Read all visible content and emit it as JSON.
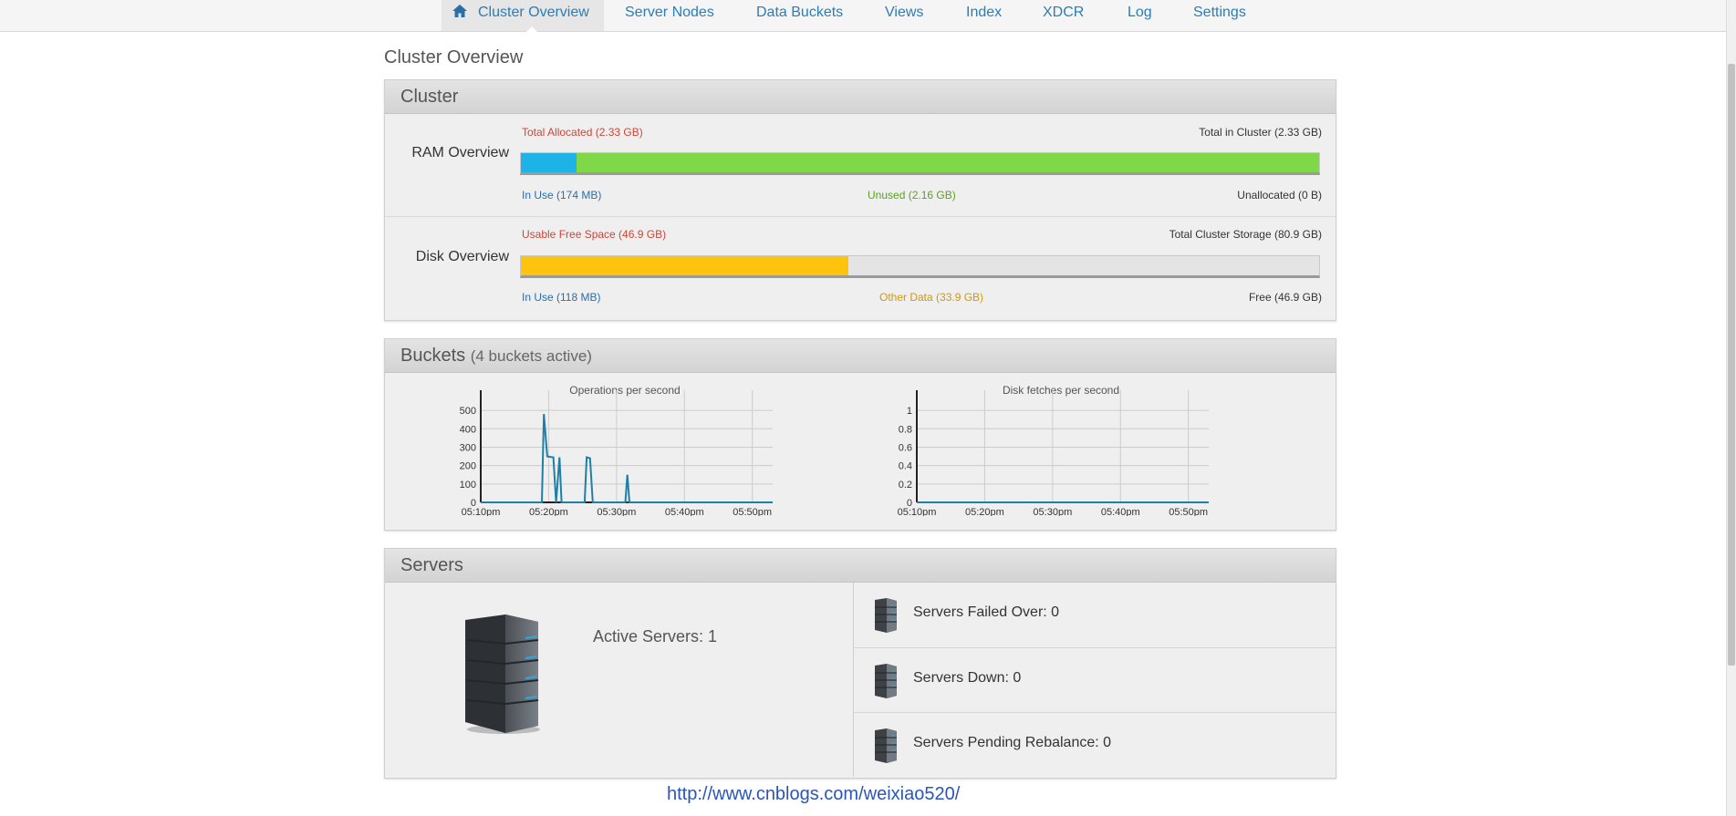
{
  "nav": {
    "items": [
      {
        "label": "Cluster Overview"
      },
      {
        "label": "Server Nodes"
      },
      {
        "label": "Data Buckets"
      },
      {
        "label": "Views"
      },
      {
        "label": "Index"
      },
      {
        "label": "XDCR"
      },
      {
        "label": "Log"
      },
      {
        "label": "Settings"
      }
    ]
  },
  "page_title": "Cluster Overview",
  "cluster": {
    "title": "Cluster",
    "ram": {
      "label": "RAM Overview",
      "total_allocated": "Total Allocated (2.33 GB)",
      "total_in_cluster": "Total in Cluster (2.33 GB)",
      "in_use": "In Use (174 MB)",
      "unused": "Unused (2.16 GB)",
      "unallocated": "Unallocated (0 B)",
      "in_use_fraction": 0.07,
      "unused_fraction": 0.93,
      "colors": {
        "in_use": "#1eb3e6",
        "unused": "#7ed848"
      }
    },
    "disk": {
      "label": "Disk Overview",
      "usable_free": "Usable Free Space (46.9 GB)",
      "total_storage": "Total Cluster Storage (80.9 GB)",
      "in_use": "In Use (118 MB)",
      "other_data": "Other Data (33.9 GB)",
      "free": "Free (46.9 GB)",
      "used_fraction": 0.41,
      "colors": {
        "used": "#fec30c",
        "free": "#e4e4e4"
      }
    }
  },
  "buckets": {
    "title": "Buckets",
    "subtitle": "(4 buckets active)"
  },
  "chart_data": [
    {
      "type": "line",
      "title": "Operations per second",
      "xlabel": "",
      "ylabel": "",
      "xticks": [
        "05:10pm",
        "05:20pm",
        "05:30pm",
        "05:40pm",
        "05:50pm"
      ],
      "yticks": [
        "0",
        "100",
        "200",
        "300",
        "400",
        "500"
      ],
      "ylim": [
        0,
        560
      ],
      "xlim_minutes": [
        0,
        43
      ],
      "grid": true,
      "series": [
        {
          "color": "#1f7fa6",
          "points": [
            [
              0,
              0
            ],
            [
              9,
              0
            ],
            [
              9.3,
              480
            ],
            [
              9.8,
              250
            ],
            [
              10.7,
              245
            ],
            [
              11.1,
              0
            ],
            [
              11.6,
              245
            ],
            [
              11.9,
              0
            ],
            [
              15.3,
              0
            ],
            [
              15.6,
              245
            ],
            [
              16.1,
              240
            ],
            [
              16.5,
              0
            ],
            [
              21.3,
              0
            ],
            [
              21.6,
              150
            ],
            [
              21.9,
              0
            ],
            [
              43,
              0
            ]
          ]
        }
      ]
    },
    {
      "type": "line",
      "title": "Disk fetches per second",
      "xlabel": "",
      "ylabel": "",
      "xticks": [
        "05:10pm",
        "05:20pm",
        "05:30pm",
        "05:40pm",
        "05:50pm"
      ],
      "yticks": [
        "0",
        "0.2",
        "0.4",
        "0.6",
        "0.8",
        "1"
      ],
      "ylim": [
        0,
        1.12
      ],
      "xlim_minutes": [
        0,
        43
      ],
      "grid": true,
      "series": [
        {
          "color": "#1f7fa6",
          "points": [
            [
              0,
              0
            ],
            [
              43,
              0
            ]
          ]
        }
      ]
    }
  ],
  "servers": {
    "title": "Servers",
    "active": "Active Servers: 1",
    "failed_over": "Servers Failed Over: 0",
    "down": "Servers Down: 0",
    "pending_rebalance": "Servers Pending Rebalance: 0"
  },
  "footer": {
    "link": "http://www.cnblogs.com/weixiao520/"
  }
}
